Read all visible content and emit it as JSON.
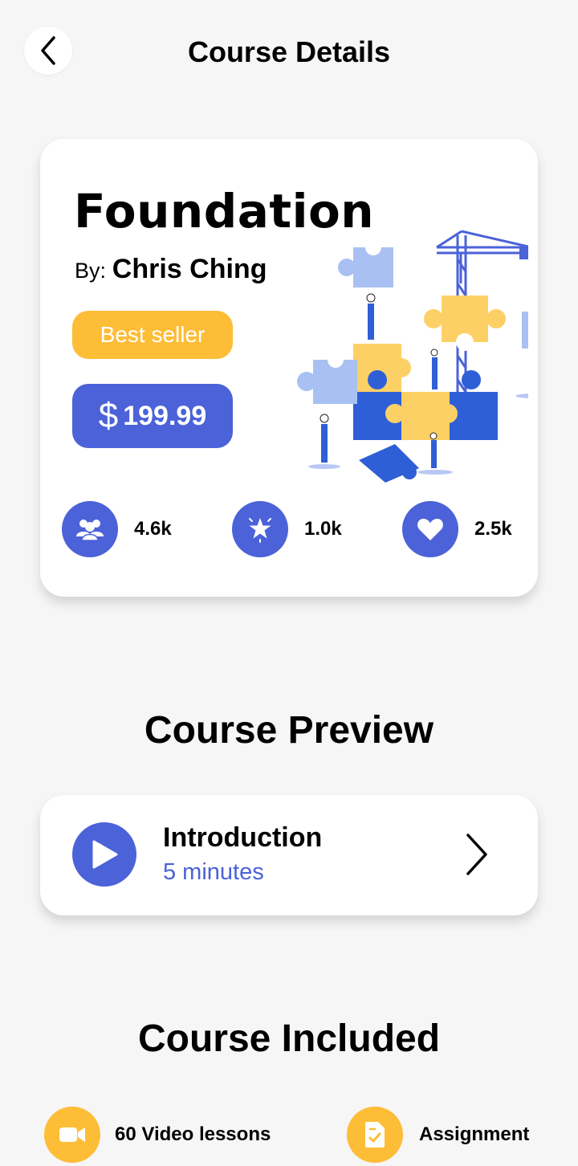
{
  "header": {
    "title": "Course Details",
    "back_icon": "chevron-left-icon"
  },
  "course": {
    "name": "Foundation",
    "author_prefix": "By:",
    "author": "Chris Ching",
    "badge": "Best seller",
    "price_currency": "$",
    "price": "199.99",
    "stats": [
      {
        "icon": "users-icon",
        "value": "4.6k"
      },
      {
        "icon": "star-badge-icon",
        "value": "1.0k"
      },
      {
        "icon": "heart-icon",
        "value": "2.5k"
      }
    ]
  },
  "preview": {
    "section_title": "Course Preview",
    "lesson_title": "Introduction",
    "lesson_duration": "5  minutes"
  },
  "included": {
    "section_title": "Course Included",
    "items": [
      {
        "icon": "video-icon",
        "label": "60 Video lessons"
      },
      {
        "icon": "assignment-icon",
        "label": "Assignment"
      }
    ]
  },
  "colors": {
    "primary": "#4b62d8",
    "accent": "#fdbd37",
    "background": "#f6f6f6"
  }
}
